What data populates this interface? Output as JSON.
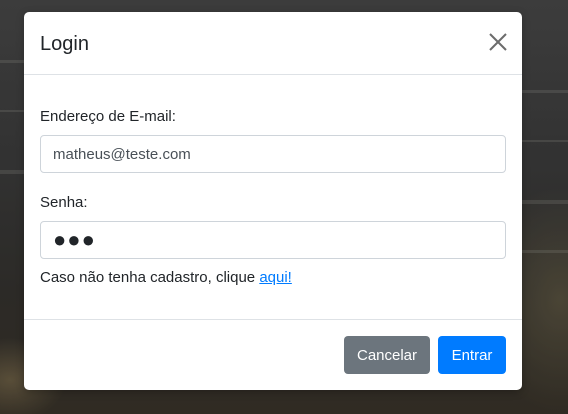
{
  "modal": {
    "title": "Login",
    "close_icon": "close-icon"
  },
  "form": {
    "email_label": "Endereço de E-mail:",
    "email_value": "matheus@teste.com",
    "password_label": "Senha:",
    "password_value": "●●●"
  },
  "signup": {
    "prompt": "Caso não tenha cadastro, clique ",
    "link_text": "aqui!"
  },
  "footer": {
    "cancel_label": "Cancelar",
    "submit_label": "Entrar"
  },
  "colors": {
    "primary": "#007bff",
    "secondary": "#6c757d",
    "border": "#dee2e6"
  }
}
